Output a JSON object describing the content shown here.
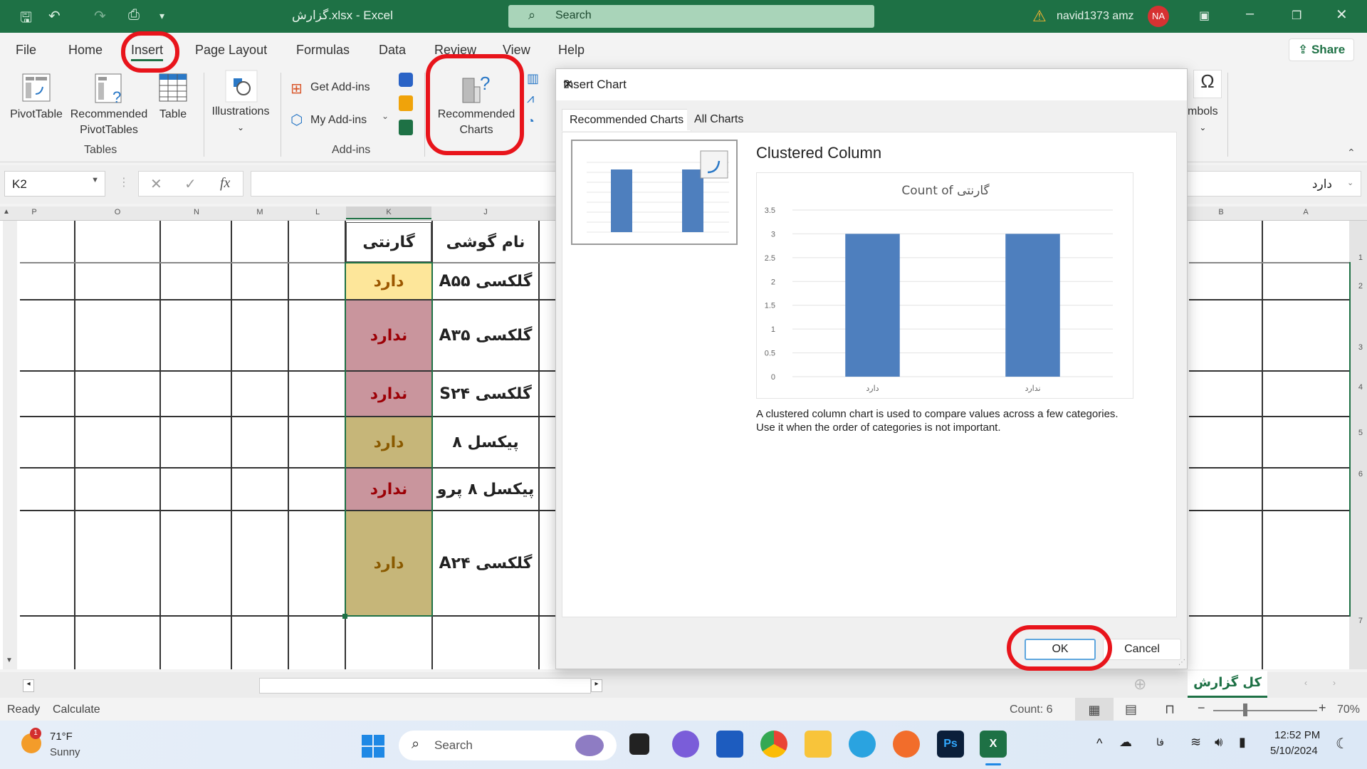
{
  "titlebar": {
    "title": "گزارش.xlsx - Excel",
    "search_placeholder": "Search",
    "user_name": "navid1373 amz",
    "avatar_initials": "NA",
    "accent_color": "#1e7145"
  },
  "menu": {
    "tabs": [
      "File",
      "Home",
      "Insert",
      "Page Layout",
      "Formulas",
      "Data",
      "Review",
      "View",
      "Help"
    ],
    "active_tab": "Insert",
    "share_label": "Share"
  },
  "ribbon": {
    "pivottable": "PivotTable",
    "recommended_pivottables_1": "Recommended",
    "recommended_pivottables_2": "PivotTables",
    "table": "Table",
    "tables_group": "Tables",
    "illustrations": "Illustrations",
    "get_addins": "Get Add-ins",
    "my_addins": "My Add-ins",
    "addins_group": "Add-ins",
    "recommended_charts_1": "Recommended",
    "recommended_charts_2": "Charts",
    "symbols": "mbols"
  },
  "formula_bar": {
    "name_box": "K2",
    "formula_value": "دارد",
    "fx_label": "fx"
  },
  "sheet": {
    "columns_left": [
      "P",
      "O",
      "N",
      "M",
      "L",
      "K",
      "J"
    ],
    "columns_right": [
      "B",
      "A"
    ],
    "row_numbers": [
      "1",
      "2",
      "3",
      "4",
      "5",
      "6",
      "7"
    ],
    "header_product": "نام گوشی",
    "header_warranty": "گارنتی",
    "rows": [
      {
        "product": "گلکسی A۵۵",
        "warranty": "دارد",
        "fill": "#fde69a",
        "text_color": "#9c5700"
      },
      {
        "product": "گلکسی A۳۵",
        "warranty": "ندارد",
        "fill": "#c9959d",
        "text_color": "#9c0006"
      },
      {
        "product": "گلکسی S۲۴",
        "warranty": "ندارد",
        "fill": "#c9959d",
        "text_color": "#9c0006"
      },
      {
        "product": "پیکسل ۸",
        "warranty": "دارد",
        "fill": "#c6b679",
        "text_color": "#8a5a00"
      },
      {
        "product": "پیکسل ۸ پرو",
        "warranty": "ندارد",
        "fill": "#c9959d",
        "text_color": "#9c0006"
      },
      {
        "product": "گلکسی A۲۴",
        "warranty": "دارد",
        "fill": "#c6b679",
        "text_color": "#8a5a00"
      }
    ],
    "sheet_tab": "کل گزارش"
  },
  "dialog": {
    "title": "Insert Chart",
    "help": "?",
    "tabs": [
      "Recommended Charts",
      "All Charts"
    ],
    "chart_type_name": "Clustered Column",
    "description_1": "A clustered column chart is used to compare values across a few categories.",
    "description_2": "Use it when the order of categories is not important.",
    "ok_label": "OK",
    "cancel_label": "Cancel"
  },
  "chart_data": {
    "type": "bar",
    "title": "Count of گارنتی",
    "categories": [
      "دارد",
      "ندارد"
    ],
    "values": [
      3,
      3
    ],
    "xlabel": "",
    "ylabel": "",
    "ylim": [
      0,
      3.5
    ],
    "yticks": [
      "0",
      "0.5",
      "1",
      "1.5",
      "2",
      "2.5",
      "3",
      "3.5"
    ],
    "grid": true,
    "bar_color": "#4e7fbe"
  },
  "statusbar": {
    "ready": "Ready",
    "calculate": "Calculate",
    "count": "Count: 6",
    "zoom": "70%"
  },
  "taskbar": {
    "weather_temp": "71°F",
    "weather_text": "Sunny",
    "weather_badge": "1",
    "search_placeholder": "Search",
    "time": "12:52 PM",
    "date": "5/10/2024",
    "lang": "فا"
  }
}
